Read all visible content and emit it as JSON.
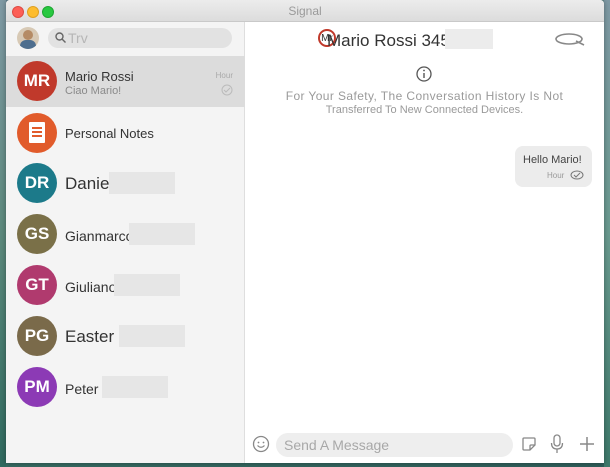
{
  "window": {
    "title": "Signal"
  },
  "sidebar": {
    "search": {
      "placeholder": "Trv"
    },
    "conversations": [
      {
        "initials": "MR",
        "name": "Mario Rossi",
        "preview": "Ciao Mario!",
        "time": "Hour",
        "color": "#c0392b",
        "selected": true
      },
      {
        "icon": "notes-icon",
        "name": "Personal Notes",
        "color": "#e15b2b"
      },
      {
        "initials": "DR",
        "name": "Daniele",
        "color": "#1c7a8a"
      },
      {
        "initials": "GS",
        "name": "Gianmarco",
        "color": "#7a7048"
      },
      {
        "initials": "GT",
        "name": "Giuliano",
        "color": "#b03a6e"
      },
      {
        "initials": "PG",
        "name": "Easter",
        "color": "#7a6a4a"
      },
      {
        "initials": "PM",
        "name": "Peter",
        "color": "#8c3ab5"
      }
    ]
  },
  "chat": {
    "header": {
      "avatar_initials": "Mr",
      "title": "Mario Rossi 345"
    },
    "notice_line1": "For Your Safety, The Conversation History Is Not",
    "notice_line2": "Transferred To New Connected Devices.",
    "messages": [
      {
        "text": "Hello Mario!",
        "time": "Hour",
        "outgoing": true
      }
    ],
    "composer": {
      "placeholder": "Send A Message"
    }
  }
}
